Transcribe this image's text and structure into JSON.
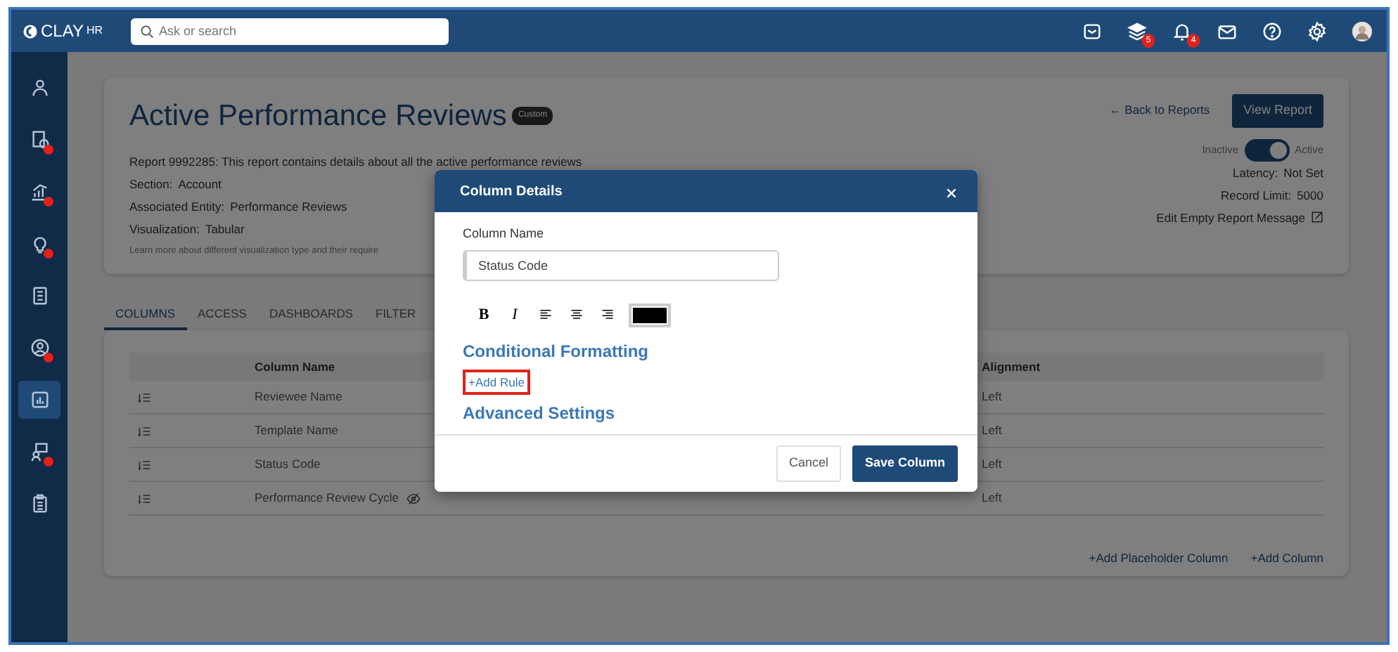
{
  "topbar": {
    "logo": "CLAY",
    "logo_suffix": "HR",
    "search": {
      "placeholder": "Ask or search"
    },
    "icons": [
      {
        "kind": "timer"
      },
      {
        "kind": "stack",
        "badge": "5"
      },
      {
        "kind": "bell",
        "badge": "4"
      },
      {
        "kind": "mail"
      },
      {
        "kind": "help"
      },
      {
        "kind": "settings"
      },
      {
        "kind": "avatar"
      }
    ]
  },
  "sidebar": {
    "items": [
      {
        "kind": "people",
        "alert": false,
        "selected": false
      },
      {
        "kind": "report",
        "alert": true,
        "selected": false
      },
      {
        "kind": "growth",
        "alert": true,
        "selected": false
      },
      {
        "kind": "bulb",
        "alert": true,
        "selected": false
      },
      {
        "kind": "document",
        "alert": false,
        "selected": false
      },
      {
        "kind": "person",
        "alert": true,
        "selected": false
      },
      {
        "kind": "chart",
        "alert": false,
        "selected": true
      },
      {
        "kind": "team",
        "alert": true,
        "selected": false
      },
      {
        "kind": "clipboard",
        "alert": false,
        "selected": false
      }
    ]
  },
  "report": {
    "title": "Active Performance Reviews",
    "badge": "Custom",
    "description": "Report 9992285: This report contains details about all the active performance reviews",
    "fields": [
      {
        "label": "Section:",
        "value": "Account"
      },
      {
        "label": "Associated Entity:",
        "value": "Performance Reviews"
      },
      {
        "label": "Visualization:",
        "value": "Tabular"
      }
    ],
    "learn_more": "Learn more about different visualization type and their require",
    "back_link": "← Back to Reports",
    "view_button": "View Report",
    "toggle": {
      "off_label": "Inactive",
      "on_label": "Active",
      "on": true
    },
    "settings": [
      {
        "label": "Latency:",
        "value": "Not Set"
      },
      {
        "label": "Record Limit:",
        "value": "5000"
      }
    ],
    "edit_empty": "Edit Empty Report Message"
  },
  "tabs": [
    {
      "label": "COLUMNS",
      "selected": true
    },
    {
      "label": "ACCESS",
      "selected": false
    },
    {
      "label": "DASHBOARDS",
      "selected": false
    },
    {
      "label": "FILTER",
      "selected": false
    }
  ],
  "table": {
    "columns": [
      "Column Name",
      "Alignment"
    ],
    "rows": [
      {
        "name": "Reviewee Name",
        "alignment": "Left",
        "hidden": false
      },
      {
        "name": "Template Name",
        "alignment": "Left",
        "hidden": false
      },
      {
        "name": "Status Code",
        "alignment": "Left",
        "hidden": false
      },
      {
        "name": "Performance Review Cycle",
        "alignment": "Left",
        "hidden": true
      }
    ],
    "links": [
      "+Add Placeholder Column",
      "+Add Column"
    ]
  },
  "modal": {
    "title": "Column Details",
    "field_label": "Column Name",
    "field_value": "Status Code",
    "tools": [
      {
        "kind": "bold",
        "label": "B"
      },
      {
        "kind": "italic",
        "label": "I"
      },
      {
        "kind": "align_left"
      },
      {
        "kind": "align_center"
      },
      {
        "kind": "align_right"
      },
      {
        "kind": "color",
        "color": "#000000"
      }
    ],
    "sections": [
      "Conditional Formatting",
      "Advanced Settings"
    ],
    "add_rule": {
      "label": "+Add Rule",
      "highlighted": true
    },
    "buttons": [
      {
        "label": "Cancel",
        "kind": "secondary"
      },
      {
        "label": "Save Column",
        "kind": "primary"
      }
    ]
  }
}
